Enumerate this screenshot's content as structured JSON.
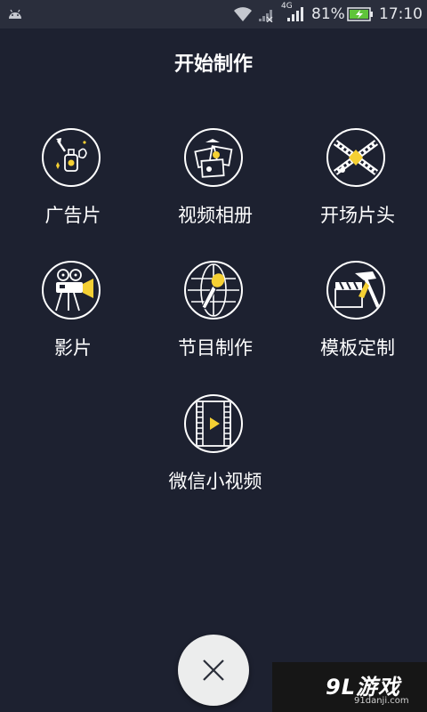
{
  "status_bar": {
    "network": "4G",
    "battery_percent": "81%",
    "time": "17:10",
    "icons": [
      "android-icon",
      "wifi-icon",
      "signal-icon",
      "battery-charging-icon"
    ]
  },
  "page_title": "开始制作",
  "menu": [
    {
      "label": "广告片",
      "icon": "perfume-bottle-icon"
    },
    {
      "label": "视频相册",
      "icon": "photo-album-icon"
    },
    {
      "label": "开场片头",
      "icon": "crossed-film-icon"
    },
    {
      "label": "影片",
      "icon": "movie-projector-icon"
    },
    {
      "label": "节目制作",
      "icon": "microphone-globe-icon"
    },
    {
      "label": "模板定制",
      "icon": "clapper-hammer-icon"
    },
    {
      "label": "微信小视频",
      "icon": "film-strip-play-icon"
    }
  ],
  "close_button": {
    "icon": "close-icon"
  },
  "watermark": {
    "logo": "9L游戏",
    "url": "91danji.com"
  },
  "colors": {
    "background": "#1d2130",
    "accent": "#f5d033",
    "close_bg": "#eceded"
  }
}
